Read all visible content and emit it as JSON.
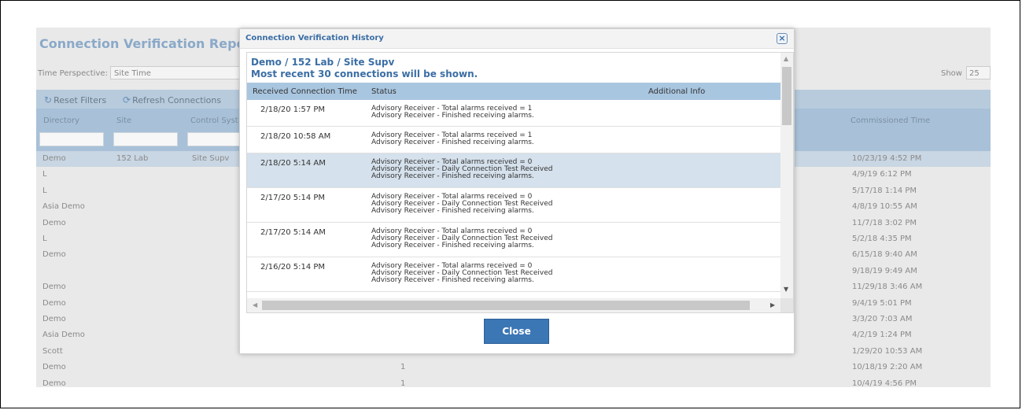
{
  "page": {
    "title": "Connection Verification Repo",
    "time_perspective_label": "Time Perspective:",
    "time_perspective_value": "Site Time",
    "show_label": "Show",
    "show_value": "25",
    "toolbar": {
      "reset_filters": "Reset Filters",
      "refresh_connections": "Refresh Connections"
    },
    "columns": [
      "Directory",
      "Site",
      "Control Syst",
      "Commissioned Time"
    ],
    "rows": [
      {
        "directory": "Demo",
        "site": "152 Lab",
        "control": "Site Supv",
        "middle": "",
        "commissioned": "10/23/19 4:52 PM",
        "highlight": true
      },
      {
        "directory": "L",
        "site": "",
        "control": "",
        "middle": "",
        "commissioned": "4/9/19 6:12 PM"
      },
      {
        "directory": "L",
        "site": "",
        "control": "",
        "middle": "",
        "commissioned": "5/17/18 1:14 PM"
      },
      {
        "directory": "Asia Demo",
        "site": "",
        "control": "",
        "middle": "",
        "commissioned": "4/8/19 10:55 AM"
      },
      {
        "directory": "Demo",
        "site": "",
        "control": "",
        "middle": "",
        "commissioned": "11/7/18 3:02 PM"
      },
      {
        "directory": "L",
        "site": "",
        "control": "",
        "middle": "",
        "commissioned": "5/2/18 4:35 PM"
      },
      {
        "directory": "Demo",
        "site": "",
        "control": "",
        "middle": "",
        "commissioned": "6/15/18 9:40 AM"
      },
      {
        "directory": "",
        "site": "",
        "control": "",
        "middle": "",
        "commissioned": "9/18/19 9:49 AM"
      },
      {
        "directory": "Demo",
        "site": "",
        "control": "",
        "middle": "",
        "commissioned": "11/29/18 3:46 AM"
      },
      {
        "directory": "Demo",
        "site": "",
        "control": "",
        "middle": "",
        "commissioned": "9/4/19 5:01 PM"
      },
      {
        "directory": "Demo",
        "site": "",
        "control": "",
        "middle": "",
        "commissioned": "3/3/20 7:03 AM"
      },
      {
        "directory": "Asia Demo",
        "site": "",
        "control": "",
        "middle": "",
        "commissioned": "4/2/19 1:24 PM"
      },
      {
        "directory": "Scott",
        "site": "",
        "control": "",
        "middle": "",
        "commissioned": "1/29/20 10:53 AM"
      },
      {
        "directory": "Demo",
        "site": "",
        "control": "",
        "middle": "1",
        "commissioned": "10/18/19 2:20 AM"
      },
      {
        "directory": "Demo",
        "site": "",
        "control": "",
        "middle": "1",
        "commissioned": "10/4/19 4:56 PM"
      }
    ]
  },
  "modal": {
    "title": "Connection Verification History",
    "close_x": "×",
    "subtitle": "Demo / 152 Lab / Site Supv",
    "note": "Most recent 30 connections will be shown.",
    "headers": {
      "time": "Received Connection Time",
      "status": "Status",
      "info": "Additional Info"
    },
    "entries": [
      {
        "time": "2/18/20 1:57 PM",
        "status": [
          "Advisory Receiver - Total alarms received = 1",
          "Advisory Receiver - Finished receiving alarms."
        ]
      },
      {
        "time": "2/18/20 10:58 AM",
        "status": [
          "Advisory Receiver - Total alarms received = 1",
          "Advisory Receiver - Finished receiving alarms."
        ]
      },
      {
        "time": "2/18/20 5:14 AM",
        "status": [
          "Advisory Receiver - Total alarms received = 0",
          "Advisory Receiver - Daily Connection Test Received",
          "Advisory Receiver - Finished receiving alarms."
        ],
        "selected": true
      },
      {
        "time": "2/17/20 5:14 PM",
        "status": [
          "Advisory Receiver - Total alarms received = 0",
          "Advisory Receiver - Daily Connection Test Received",
          "Advisory Receiver - Finished receiving alarms."
        ]
      },
      {
        "time": "2/17/20 5:14 AM",
        "status": [
          "Advisory Receiver - Total alarms received = 0",
          "Advisory Receiver - Daily Connection Test Received",
          "Advisory Receiver - Finished receiving alarms."
        ]
      },
      {
        "time": "2/16/20 5:14 PM",
        "status": [
          "Advisory Receiver - Total alarms received = 0",
          "Advisory Receiver - Daily Connection Test Received",
          "Advisory Receiver - Finished receiving alarms."
        ]
      }
    ],
    "close_button": "Close"
  }
}
